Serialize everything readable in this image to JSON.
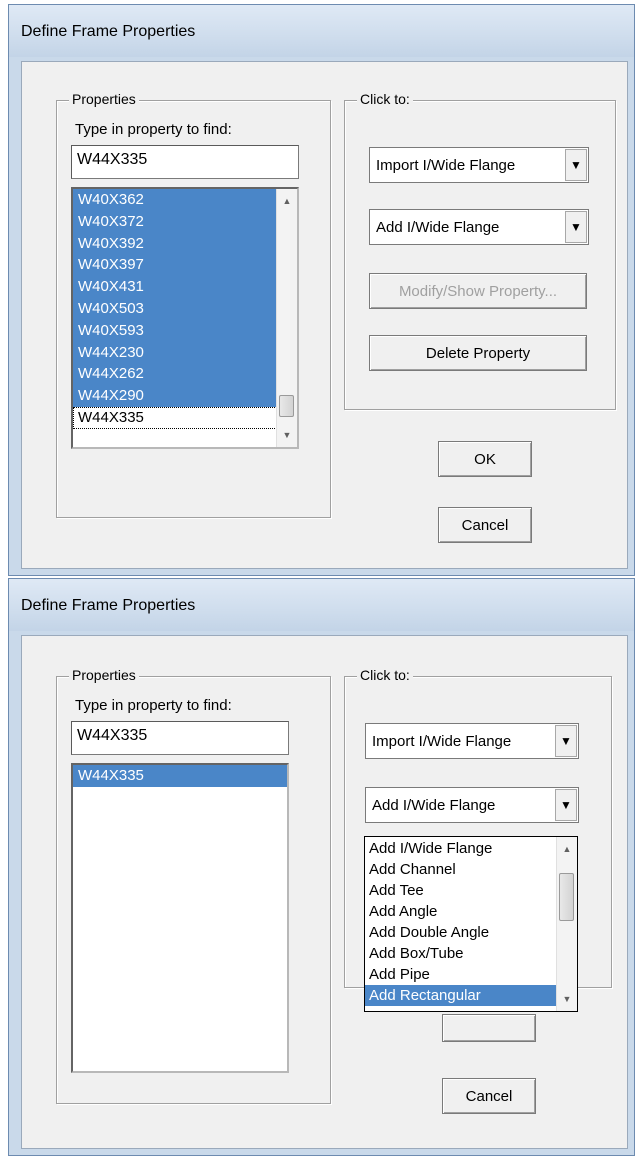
{
  "dialog1": {
    "title": "Define Frame Properties",
    "properties_group": "Properties",
    "find_label": "Type in property to find:",
    "find_value": "W44X335",
    "list_items": [
      "W40X362",
      "W40X372",
      "W40X392",
      "W40X397",
      "W40X431",
      "W40X503",
      "W40X593",
      "W44X230",
      "W44X262",
      "W44X290",
      "W44X335"
    ],
    "click_group": "Click to:",
    "import_combo": "Import I/Wide Flange",
    "add_combo": "Add I/Wide Flange",
    "modify_button": "Modify/Show Property...",
    "delete_button": "Delete Property",
    "ok_button": "OK",
    "cancel_button": "Cancel"
  },
  "dialog2": {
    "title": "Define Frame Properties",
    "properties_group": "Properties",
    "find_label": "Type in property to find:",
    "find_value": "W44X335",
    "list_items": [
      "W44X335"
    ],
    "click_group": "Click to:",
    "import_combo": "Import I/Wide Flange",
    "add_combo": "Add I/Wide Flange",
    "dropdown_options": [
      "Add I/Wide Flange",
      "Add Channel",
      "Add Tee",
      "Add Angle",
      "Add Double Angle",
      "Add Box/Tube",
      "Add Pipe",
      "Add Rectangular"
    ],
    "dropdown_selected": "Add Rectangular",
    "cancel_button": "Cancel"
  },
  "icons": {
    "dropdown": "chevron-down-icon",
    "scroll_up": "scroll-up-arrow-icon",
    "scroll_down": "scroll-down-arrow-icon"
  }
}
